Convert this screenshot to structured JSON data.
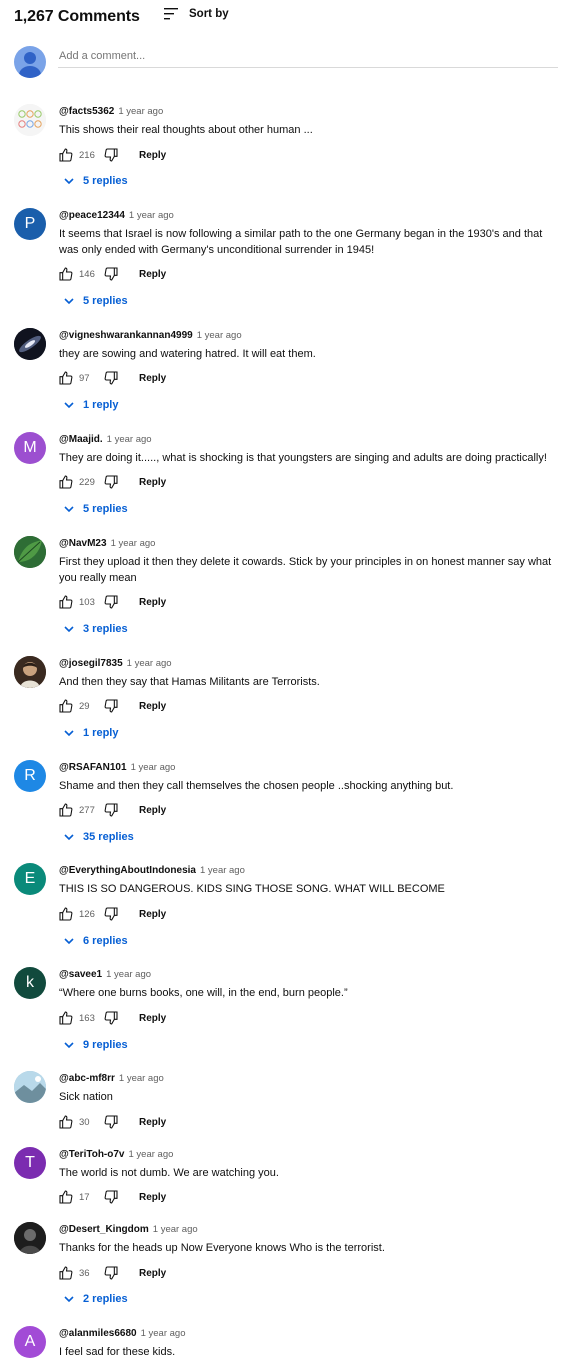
{
  "header": {
    "count": "1,267 Comments",
    "sort_label": "Sort by"
  },
  "add_comment": {
    "placeholder": "Add a comment..."
  },
  "comments": [
    {
      "author": "@facts5362",
      "time": "1 year ago",
      "text": "This shows their real thoughts about other human ...",
      "likes": "216",
      "reply": "Reply",
      "replies": "5 replies",
      "avatar": {
        "letter": "",
        "color": "#f2f2f2",
        "icon": "pattern-avatar"
      }
    },
    {
      "author": "@peace12344",
      "time": "1 year ago",
      "text": "It seems that Israel is now following a similar path to the one Germany began in the 1930's and that was only ended with Germany's unconditional surrender in 1945!",
      "likes": "146",
      "reply": "Reply",
      "replies": "5 replies",
      "avatar": {
        "letter": "P",
        "color": "#1a5eab"
      }
    },
    {
      "author": "@vigneshwarankannan4999",
      "time": "1 year ago",
      "text": "they are sowing and watering hatred. It will eat them.",
      "likes": "97",
      "reply": "Reply",
      "replies": "1 reply",
      "avatar": {
        "letter": "",
        "color": "#1b2030",
        "icon": "galaxy-photo"
      }
    },
    {
      "author": "@Maajid.",
      "time": "1 year ago",
      "text": "They are doing it....., what is shocking is that youngsters are singing and adults are doing practically!",
      "likes": "229",
      "reply": "Reply",
      "replies": "5 replies",
      "avatar": {
        "letter": "M",
        "color": "#9c4fd0"
      }
    },
    {
      "author": "@NavM23",
      "time": "1 year ago",
      "text": "First they upload it then they delete it cowards. Stick by your principles in on honest manner say what you really mean",
      "likes": "103",
      "reply": "Reply",
      "replies": "3 replies",
      "avatar": {
        "letter": "",
        "color": "#1f5a2b",
        "icon": "leaf-photo"
      }
    },
    {
      "author": "@josegil7835",
      "time": "1 year ago",
      "text": "And then they say that Hamas Militants are Terrorists.",
      "likes": "29",
      "reply": "Reply",
      "replies": "1 reply",
      "avatar": {
        "letter": "",
        "color": "#5a4030",
        "icon": "portrait-photo"
      }
    },
    {
      "author": "@RSAFAN101",
      "time": "1 year ago",
      "text": "Shame and then they call themselves the chosen people ..shocking anything but.",
      "likes": "277",
      "reply": "Reply",
      "replies": "35 replies",
      "avatar": {
        "letter": "R",
        "color": "#1e88e5"
      }
    },
    {
      "author": "@EverythingAboutIndonesia",
      "time": "1 year ago",
      "text": "THIS IS SO DANGEROUS. KIDS SING THOSE SONG. WHAT WILL BECOME",
      "likes": "126",
      "reply": "Reply",
      "replies": "6 replies",
      "avatar": {
        "letter": "E",
        "color": "#0a8a7a"
      }
    },
    {
      "author": "@savee1",
      "time": "1 year ago",
      "text": "“Where one burns books, one will, in the end, burn people.”",
      "likes": "163",
      "reply": "Reply",
      "replies": "9 replies",
      "avatar": {
        "letter": "k",
        "color": "#114a3d"
      }
    },
    {
      "author": "@abc-mf8rr",
      "time": "1 year ago",
      "text": "Sick nation",
      "likes": "30",
      "reply": "Reply",
      "replies": "",
      "avatar": {
        "letter": "",
        "color": "#9cc4d8",
        "icon": "landscape-photo"
      }
    },
    {
      "author": "@TeriToh-o7v",
      "time": "1 year ago",
      "text": "The world is not dumb. We are watching you.",
      "likes": "17",
      "reply": "Reply",
      "replies": "",
      "avatar": {
        "letter": "T",
        "color": "#7b2cb0"
      }
    },
    {
      "author": "@Desert_Kingdom",
      "time": "1 year ago",
      "text": "Thanks for the heads up Now Everyone knows Who is the terrorist.",
      "likes": "36",
      "reply": "Reply",
      "replies": "2 replies",
      "avatar": {
        "letter": "",
        "color": "#2a2a2a",
        "icon": "dark-photo"
      }
    },
    {
      "author": "@alanmiles6680",
      "time": "1 year ago",
      "text": "I feel sad for these kids.",
      "likes": "",
      "reply": "",
      "replies": "",
      "avatar": {
        "letter": "A",
        "color": "#a24bd6"
      }
    }
  ]
}
